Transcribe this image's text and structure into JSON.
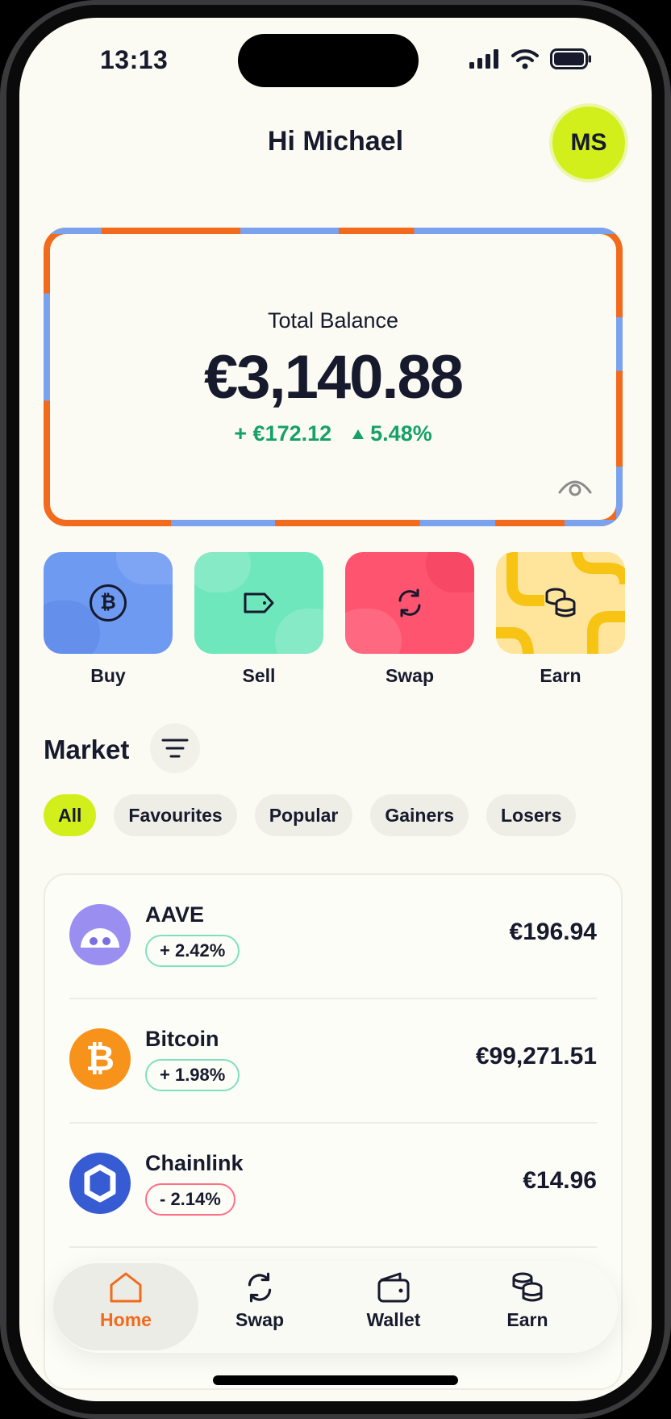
{
  "status_bar": {
    "time": "13:13"
  },
  "header": {
    "greeting": "Hi Michael",
    "avatar_initials": "MS"
  },
  "balance": {
    "label": "Total Balance",
    "value": "€3,140.88",
    "change_amount": "+ €172.12",
    "change_percent": "5.48%",
    "positive_color": "#16a06a"
  },
  "actions": [
    {
      "label": "Buy",
      "icon": "bitcoin-circle-icon",
      "color": "#6f9af2"
    },
    {
      "label": "Sell",
      "icon": "tag-icon",
      "color": "#6fe7bd"
    },
    {
      "label": "Swap",
      "icon": "swap-arrows-icon",
      "color": "#ff5470"
    },
    {
      "label": "Earn",
      "icon": "coins-stack-icon",
      "color": "#ffe59b"
    }
  ],
  "market": {
    "title": "Market",
    "filters": [
      "All",
      "Favourites",
      "Popular",
      "Gainers",
      "Losers"
    ],
    "active_filter": "All",
    "coins": [
      {
        "name": "AAVE",
        "change": "+ 2.42%",
        "price": "€196.94",
        "icon": "aave-icon",
        "icon_color": "#9a8ff0"
      },
      {
        "name": "Bitcoin",
        "change": "+ 1.98%",
        "price": "€99,271.51",
        "icon": "bitcoin-icon",
        "icon_color": "#f7931a"
      },
      {
        "name": "Chainlink",
        "change": "- 2.14%",
        "price": "€14.96",
        "icon": "chainlink-icon",
        "icon_color": "#375bd2"
      }
    ]
  },
  "tabbar": {
    "tabs": [
      {
        "label": "Home",
        "icon": "home-icon"
      },
      {
        "label": "Swap",
        "icon": "swap-icon"
      },
      {
        "label": "Wallet",
        "icon": "wallet-icon"
      },
      {
        "label": "Earn",
        "icon": "coins-icon"
      }
    ],
    "active": "Home",
    "accent": "#f26a1b"
  }
}
